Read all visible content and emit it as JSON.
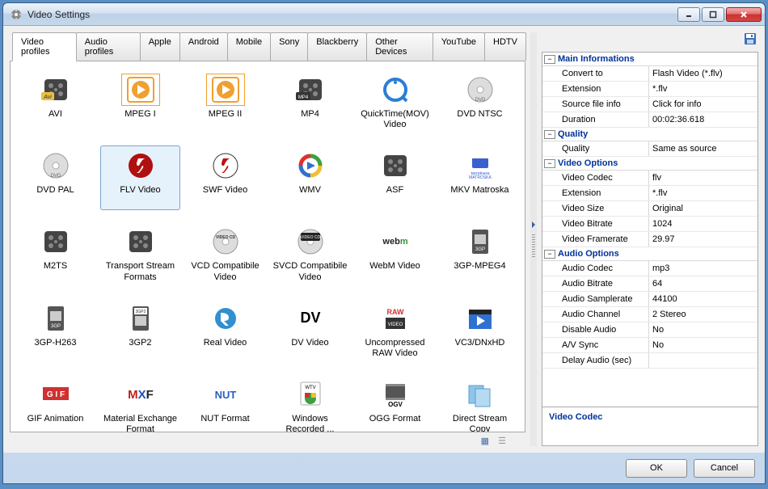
{
  "window": {
    "title": "Video Settings"
  },
  "tabs": [
    {
      "label": "Video profiles",
      "active": true
    },
    {
      "label": "Audio profiles"
    },
    {
      "label": "Apple"
    },
    {
      "label": "Android"
    },
    {
      "label": "Mobile"
    },
    {
      "label": "Sony"
    },
    {
      "label": "Blackberry"
    },
    {
      "label": "Other Devices"
    },
    {
      "label": "YouTube"
    },
    {
      "label": "HDTV"
    }
  ],
  "formats": [
    {
      "label": "AVI",
      "icon": "avi"
    },
    {
      "label": "MPEG I",
      "icon": "play-orange",
      "boxed": true
    },
    {
      "label": "MPEG II",
      "icon": "play-orange",
      "boxed": true
    },
    {
      "label": "MP4",
      "icon": "mp4"
    },
    {
      "label": "QuickTime(MOV) Video",
      "icon": "qt"
    },
    {
      "label": "DVD NTSC",
      "icon": "dvd"
    },
    {
      "label": "DVD PAL",
      "icon": "dvd"
    },
    {
      "label": "FLV Video",
      "icon": "flash",
      "selected": true
    },
    {
      "label": "SWF Video",
      "icon": "swf"
    },
    {
      "label": "WMV",
      "icon": "wmv"
    },
    {
      "label": "ASF",
      "icon": "reel"
    },
    {
      "label": "MKV Matroska",
      "icon": "mkv"
    },
    {
      "label": "M2TS",
      "icon": "reel"
    },
    {
      "label": "Transport Stream Formats",
      "icon": "reel"
    },
    {
      "label": "VCD Compatibile Video",
      "icon": "vcd"
    },
    {
      "label": "SVCD Compatibile Video",
      "icon": "svcd"
    },
    {
      "label": "WebM Video",
      "icon": "webm"
    },
    {
      "label": "3GP-MPEG4",
      "icon": "3gp"
    },
    {
      "label": "3GP-H263",
      "icon": "3gp"
    },
    {
      "label": "3GP2",
      "icon": "3gp2"
    },
    {
      "label": "Real Video",
      "icon": "real"
    },
    {
      "label": "DV Video",
      "icon": "dv"
    },
    {
      "label": "Uncompressed RAW Video",
      "icon": "raw"
    },
    {
      "label": "VC3/DNxHD",
      "icon": "clapper"
    },
    {
      "label": "GIF Animation",
      "icon": "gif"
    },
    {
      "label": "Material Exchange Format",
      "icon": "mxf"
    },
    {
      "label": "NUT Format",
      "icon": "nut"
    },
    {
      "label": "Windows Recorded ...",
      "icon": "wtv"
    },
    {
      "label": "OGG Format",
      "icon": "ogv"
    },
    {
      "label": "Direct Stream Copy",
      "icon": "copy"
    }
  ],
  "prop_sections": [
    {
      "title": "Main Informations",
      "rows": [
        {
          "key": "Convert to",
          "val": "Flash Video (*.flv)"
        },
        {
          "key": "Extension",
          "val": "*.flv"
        },
        {
          "key": "Source file info",
          "val": "Click for info"
        },
        {
          "key": "Duration",
          "val": "00:02:36.618"
        }
      ]
    },
    {
      "title": "Quality",
      "rows": [
        {
          "key": "Quality",
          "val": "Same as source"
        }
      ]
    },
    {
      "title": "Video Options",
      "rows": [
        {
          "key": "Video Codec",
          "val": "flv"
        },
        {
          "key": "Extension",
          "val": "*.flv"
        },
        {
          "key": "Video Size",
          "val": "Original"
        },
        {
          "key": "Video Bitrate",
          "val": "1024"
        },
        {
          "key": "Video Framerate",
          "val": "29.97"
        }
      ]
    },
    {
      "title": "Audio Options",
      "rows": [
        {
          "key": "Audio Codec",
          "val": "mp3"
        },
        {
          "key": "Audio Bitrate",
          "val": "64"
        },
        {
          "key": "Audio Samplerate",
          "val": "44100"
        },
        {
          "key": "Audio Channel",
          "val": "2 Stereo"
        },
        {
          "key": "Disable Audio",
          "val": "No"
        },
        {
          "key": "A/V Sync",
          "val": "No"
        },
        {
          "key": "Delay Audio (sec)",
          "val": ""
        }
      ]
    }
  ],
  "prop_desc": "Video Codec",
  "buttons": {
    "ok": "OK",
    "cancel": "Cancel"
  }
}
